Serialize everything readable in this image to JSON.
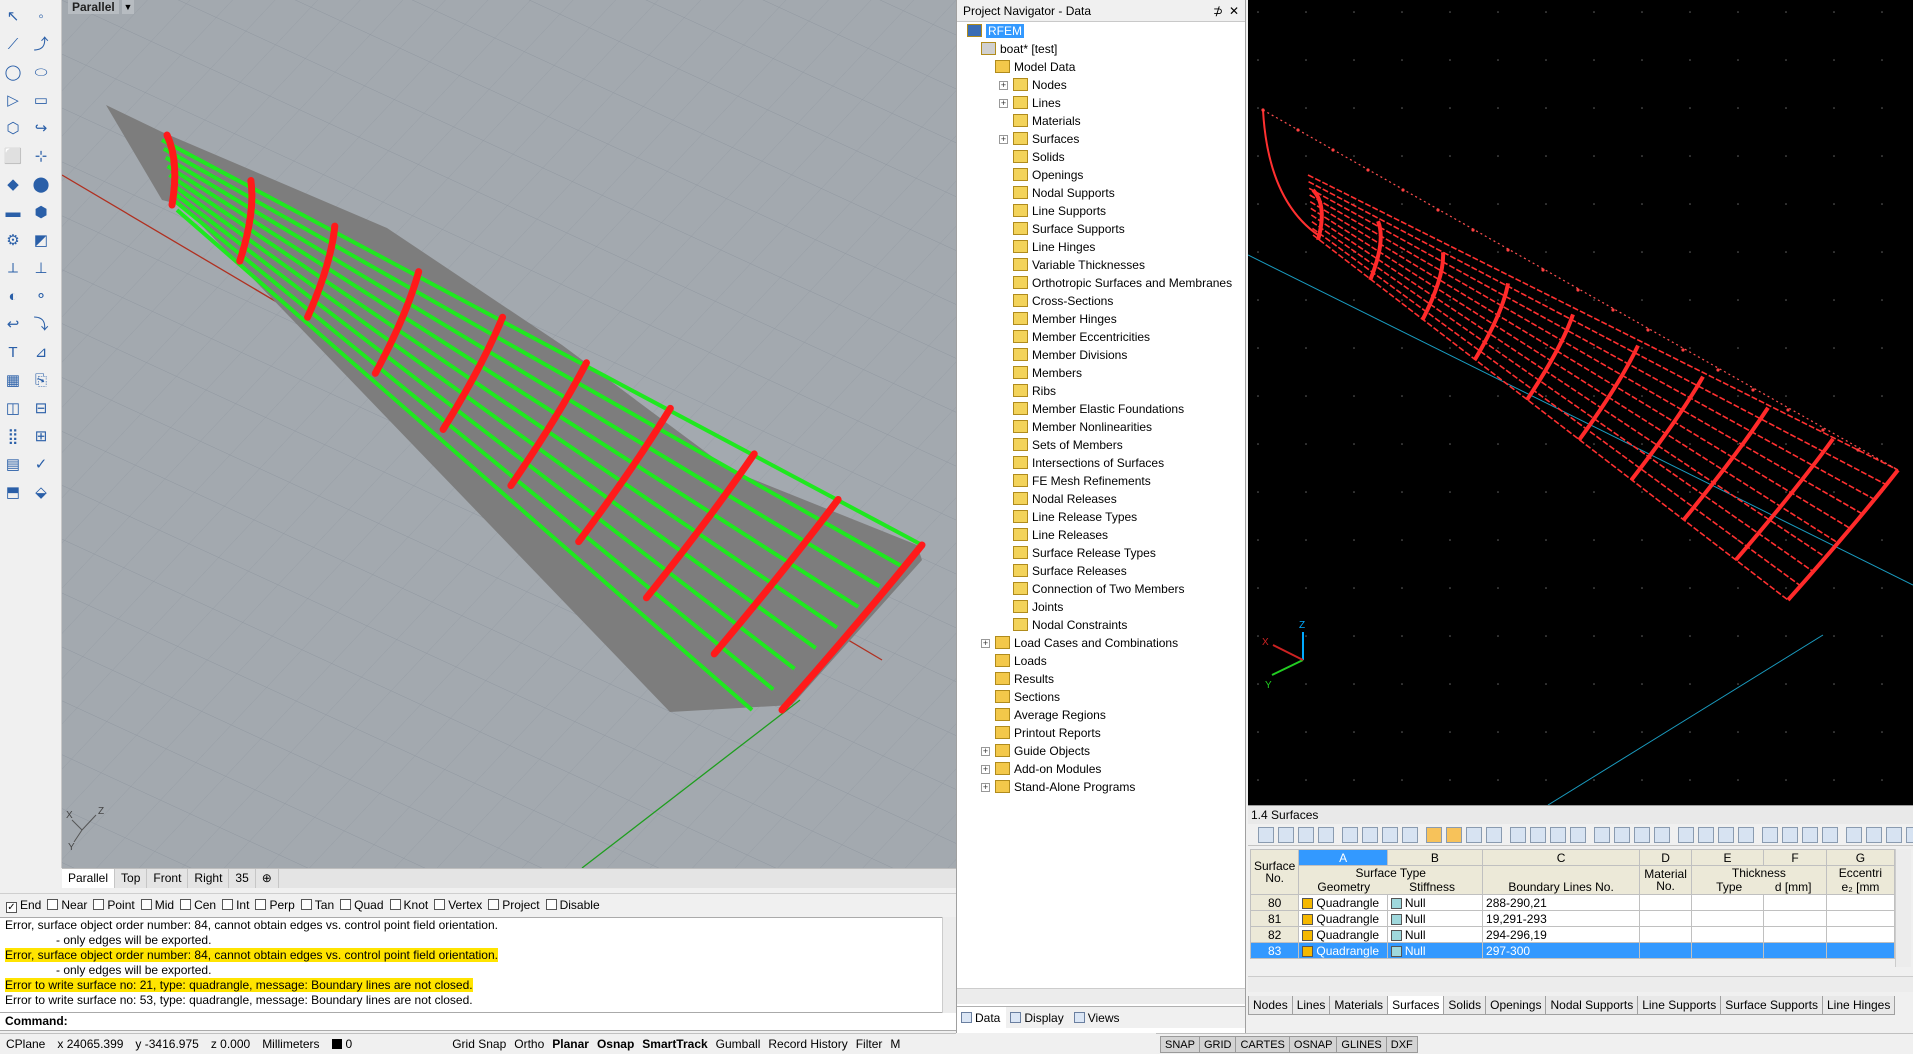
{
  "rhino": {
    "viewport_label": "Parallel",
    "view_tabs": [
      "Parallel",
      "Top",
      "Front",
      "Right",
      "35"
    ],
    "view_tab_add": "⊕",
    "osnap": [
      {
        "label": "End",
        "checked": true
      },
      {
        "label": "Near",
        "checked": false
      },
      {
        "label": "Point",
        "checked": false
      },
      {
        "label": "Mid",
        "checked": false
      },
      {
        "label": "Cen",
        "checked": false
      },
      {
        "label": "Int",
        "checked": false
      },
      {
        "label": "Perp",
        "checked": false
      },
      {
        "label": "Tan",
        "checked": false
      },
      {
        "label": "Quad",
        "checked": false
      },
      {
        "label": "Knot",
        "checked": false
      },
      {
        "label": "Vertex",
        "checked": false
      },
      {
        "label": "Project",
        "checked": false
      },
      {
        "label": "Disable",
        "checked": false
      }
    ],
    "history": [
      {
        "text": "Error, surface object order number: 84, cannot obtain edges vs. control point field orientation.",
        "highlight": false,
        "indent": false
      },
      {
        "text": "- only edges will be exported.",
        "highlight": false,
        "indent": true
      },
      {
        "text": "Error, surface object order number: 84, cannot obtain edges vs. control point field orientation.",
        "highlight": true,
        "indent": false
      },
      {
        "text": "- only edges will be exported.",
        "highlight": false,
        "indent": true
      },
      {
        "text": "Error to write surface no: 21, type: quadrangle, message: Boundary lines are not closed.",
        "highlight": true,
        "indent": false
      },
      {
        "text": "Error to write surface no: 53, type: quadrangle, message: Boundary lines are not closed.",
        "highlight": false,
        "indent": false
      }
    ],
    "command_label": "Command:",
    "status": {
      "cplane": "CPlane",
      "x": "x 24065.399",
      "y": "y -3416.975",
      "z": "z 0.000",
      "units": "Millimeters",
      "layer": "0",
      "items": [
        "Grid Snap",
        "Ortho",
        "Planar",
        "Osnap",
        "SmartTrack",
        "Gumball",
        "Record History",
        "Filter",
        "M"
      ],
      "bold_items": [
        "Planar",
        "Osnap",
        "SmartTrack"
      ]
    }
  },
  "navigator": {
    "title": "Project Navigator - Data",
    "pin": "⊅",
    "close": "✕",
    "root": "RFEM",
    "project": "boat* [test]",
    "model_data": "Model Data",
    "model_items": [
      {
        "label": "Nodes",
        "expand": true
      },
      {
        "label": "Lines",
        "expand": true
      },
      {
        "label": "Materials",
        "expand": false
      },
      {
        "label": "Surfaces",
        "expand": true
      },
      {
        "label": "Solids",
        "expand": false
      },
      {
        "label": "Openings",
        "expand": false
      },
      {
        "label": "Nodal Supports",
        "expand": false
      },
      {
        "label": "Line Supports",
        "expand": false
      },
      {
        "label": "Surface Supports",
        "expand": false
      },
      {
        "label": "Line Hinges",
        "expand": false
      },
      {
        "label": "Variable Thicknesses",
        "expand": false
      },
      {
        "label": "Orthotropic Surfaces and Membranes",
        "expand": false
      },
      {
        "label": "Cross-Sections",
        "expand": false
      },
      {
        "label": "Member Hinges",
        "expand": false
      },
      {
        "label": "Member Eccentricities",
        "expand": false
      },
      {
        "label": "Member Divisions",
        "expand": false
      },
      {
        "label": "Members",
        "expand": false
      },
      {
        "label": "Ribs",
        "expand": false
      },
      {
        "label": "Member Elastic Foundations",
        "expand": false
      },
      {
        "label": "Member Nonlinearities",
        "expand": false
      },
      {
        "label": "Sets of Members",
        "expand": false
      },
      {
        "label": "Intersections of Surfaces",
        "expand": false
      },
      {
        "label": "FE Mesh Refinements",
        "expand": false
      },
      {
        "label": "Nodal Releases",
        "expand": false
      },
      {
        "label": "Line Release Types",
        "expand": false
      },
      {
        "label": "Line Releases",
        "expand": false
      },
      {
        "label": "Surface Release Types",
        "expand": false
      },
      {
        "label": "Surface Releases",
        "expand": false
      },
      {
        "label": "Connection of Two Members",
        "expand": false
      },
      {
        "label": "Joints",
        "expand": false
      },
      {
        "label": "Nodal Constraints",
        "expand": false
      }
    ],
    "top_items": [
      {
        "label": "Load Cases and Combinations",
        "expand": true
      },
      {
        "label": "Loads",
        "expand": false
      },
      {
        "label": "Results",
        "expand": false
      },
      {
        "label": "Sections",
        "expand": false
      },
      {
        "label": "Average Regions",
        "expand": false
      },
      {
        "label": "Printout Reports",
        "expand": false
      },
      {
        "label": "Guide Objects",
        "expand": true
      },
      {
        "label": "Add-on Modules",
        "expand": true
      },
      {
        "label": "Stand-Alone Programs",
        "expand": true
      }
    ],
    "tabs": [
      "Data",
      "Display",
      "Views"
    ]
  },
  "table": {
    "title": "1.4 Surfaces",
    "col_letters": [
      "A",
      "B",
      "C",
      "D",
      "E",
      "F",
      "G"
    ],
    "header_surface": "Surface No.",
    "header_surface_type": "Surface Type",
    "header_geometry": "Geometry",
    "header_stiffness": "Stiffness",
    "header_boundary": "Boundary Lines No.",
    "header_material": "Material No.",
    "header_thickness": "Thickness",
    "header_type": "Type",
    "header_d": "d [mm]",
    "header_ecc": "Eccentri",
    "header_ez": "e₂ [mm",
    "rows": [
      {
        "no": "80",
        "geometry": "Quadrangle",
        "stiffness": "Null",
        "lines": "288-290,21",
        "selected": false
      },
      {
        "no": "81",
        "geometry": "Quadrangle",
        "stiffness": "Null",
        "lines": "19,291-293",
        "selected": false
      },
      {
        "no": "82",
        "geometry": "Quadrangle",
        "stiffness": "Null",
        "lines": "294-296,19",
        "selected": false
      },
      {
        "no": "83",
        "geometry": "Quadrangle",
        "stiffness": "Null",
        "lines": "297-300",
        "selected": true
      }
    ],
    "tabs": [
      "Nodes",
      "Lines",
      "Materials",
      "Surfaces",
      "Solids",
      "Openings",
      "Nodal Supports",
      "Line Supports",
      "Surface Supports",
      "Line Hinges"
    ],
    "active_tab": "Surfaces"
  },
  "rfem_status": [
    "SNAP",
    "GRID",
    "CARTES",
    "OSNAP",
    "GLINES",
    "DXF"
  ],
  "axes": {
    "z": "Z",
    "x": "X",
    "y": "Y"
  },
  "colors": {
    "rib": "#ff1a1a",
    "stringer": "#1fe81f",
    "hull": "#7b7b7b",
    "selection": "#3399ff",
    "highlight": "#ffe400"
  }
}
